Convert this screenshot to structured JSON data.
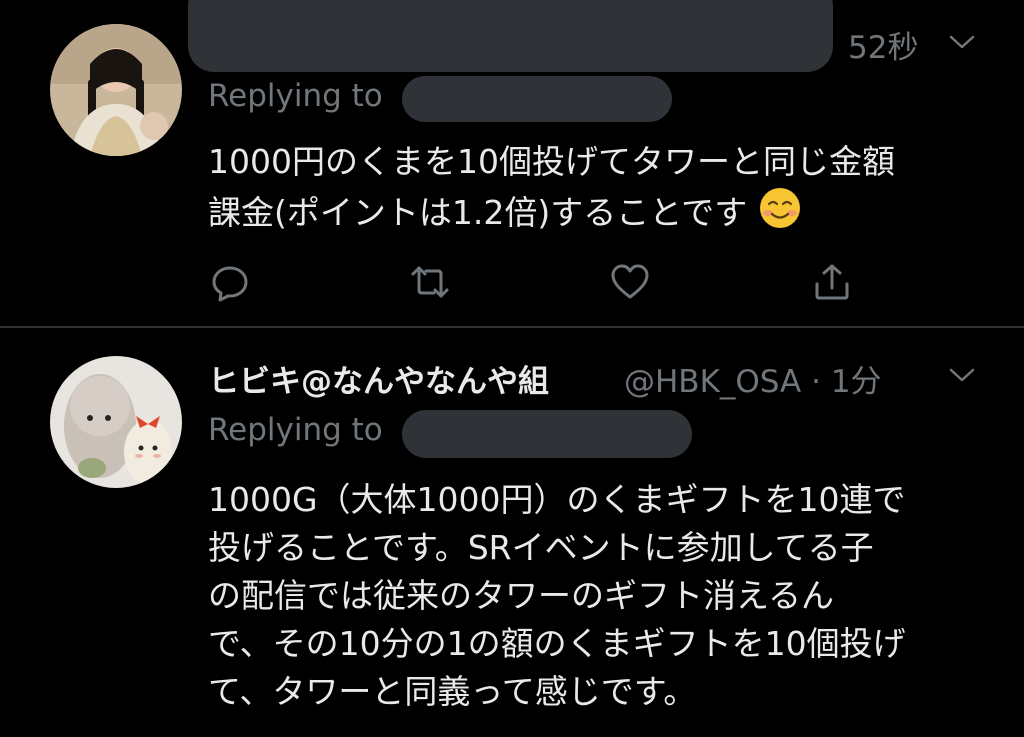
{
  "tweets": [
    {
      "timestamp": "52秒",
      "replying_label": "Replying to",
      "body_lines": [
        "1000円のくまを10個投げてタワーと同じ金額",
        "課金(ポイントは1.2倍)することです"
      ],
      "emoji": "smiling-face-icon",
      "actions": [
        "reply-icon",
        "retweet-icon",
        "like-icon",
        "share-icon"
      ]
    },
    {
      "display_name": "ヒビキ@なんやなんや組",
      "handle_time": "@HBK_OSA · 1分",
      "replying_label": "Replying to",
      "body_lines": [
        "1000G（大体1000円）のくまギフトを10連で",
        "投げることです。SRイベントに参加してる子",
        "の配信では従来のタワーのギフト消えるん",
        "で、その10分の1の額のくまギフトを10個投げ",
        "て、タワーと同義って感じです。"
      ]
    }
  ],
  "colors": {
    "background": "#000000",
    "text_primary": "#e7e9ea",
    "text_secondary": "#71767b",
    "divider": "#2f3336",
    "redaction": "#2f3338"
  }
}
